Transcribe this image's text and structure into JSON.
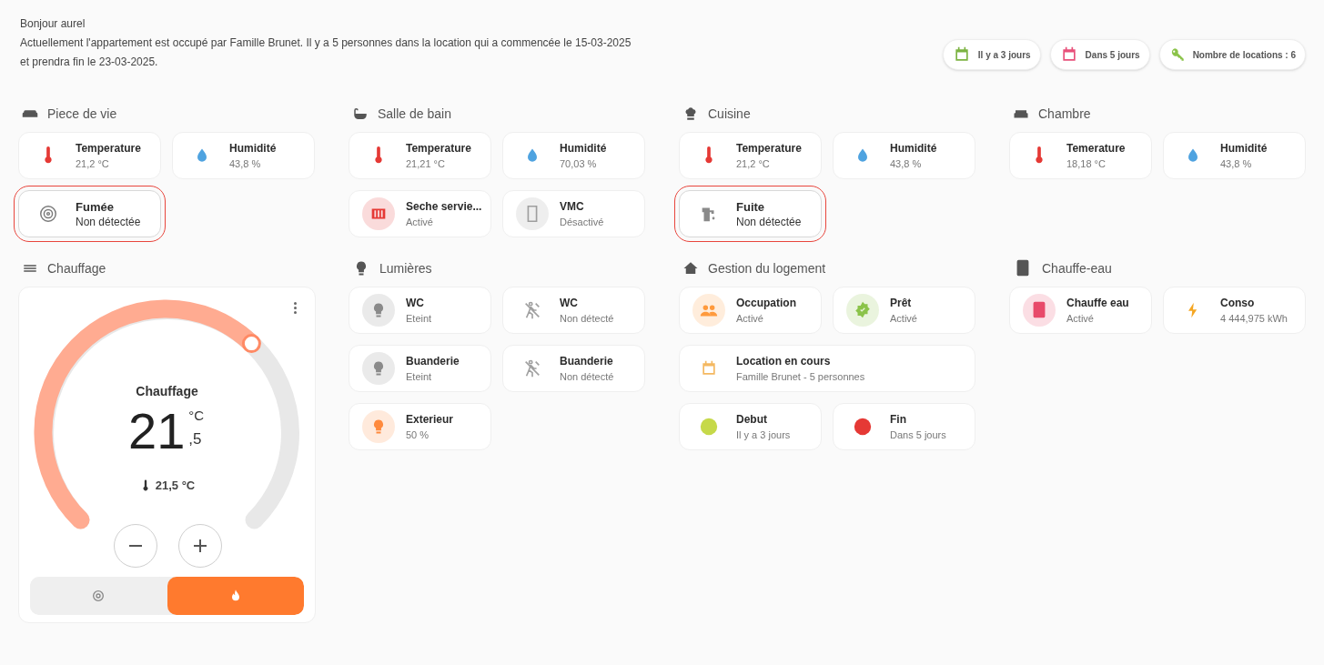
{
  "greeting": "Bonjour aurel",
  "summary": "Actuellement l'appartement est occupé par Famille Brunet. Il y a 5 personnes dans la location qui a commencée le 15-03-2025 et prendra fin le 23-03-2025.",
  "chips": [
    {
      "color": "#7cb342",
      "label": "Il y a 3 jours"
    },
    {
      "color": "#e8507a",
      "label": "Dans 5 jours"
    },
    {
      "color": "#8bc34a",
      "label": "Nombre de locations : 6"
    }
  ],
  "sections": [
    {
      "kind": "tiles",
      "title": "Piece de vie",
      "tiles": [
        {
          "title": "Temperature",
          "state": "21,2 °C",
          "kind": "thermometer",
          "color": "#e53935",
          "filled": false,
          "highlighted": false
        },
        {
          "title": "Humidité",
          "state": "43,8 %",
          "kind": "drop",
          "color": "#4fa3e0",
          "filled": false,
          "highlighted": false
        },
        {
          "title": "Fumée",
          "state": "Non détectée",
          "kind": "smoke",
          "color": "#7a7a7a",
          "filled": false,
          "highlighted": true
        }
      ]
    },
    {
      "kind": "tiles",
      "title": "Salle de bain",
      "tiles": [
        {
          "title": "Temperature",
          "state": "21,21 °C",
          "kind": "thermometer",
          "color": "#e53935",
          "filled": false,
          "highlighted": false
        },
        {
          "title": "Humidité",
          "state": "70,03 %",
          "kind": "drop",
          "color": "#4fa3e0",
          "filled": false,
          "highlighted": false
        },
        {
          "title": "Seche servie...",
          "state": "Activé",
          "kind": "radiator",
          "color": "#e53935",
          "filled": true,
          "highlighted": false
        },
        {
          "title": "VMC",
          "state": "Désactivé",
          "kind": "phone",
          "color": "#9e9e9e",
          "filled": true,
          "highlighted": false
        }
      ]
    },
    {
      "kind": "tiles",
      "title": "Cuisine",
      "tiles": [
        {
          "title": "Temperature",
          "state": "21,2 °C",
          "kind": "thermometer",
          "color": "#e53935",
          "filled": false,
          "highlighted": false
        },
        {
          "title": "Humidité",
          "state": "43,8 %",
          "kind": "drop",
          "color": "#4fa3e0",
          "filled": false,
          "highlighted": false
        },
        {
          "title": "Fuite",
          "state": "Non détectée",
          "kind": "faucet",
          "color": "#8a8a8a",
          "filled": false,
          "highlighted": true
        }
      ]
    },
    {
      "kind": "tiles",
      "title": "Chambre",
      "tiles": [
        {
          "title": "Temerature",
          "state": "18,18 °C",
          "kind": "thermometer",
          "color": "#e53935",
          "filled": false,
          "highlighted": false
        },
        {
          "title": "Humidité",
          "state": "43,8 %",
          "kind": "drop",
          "color": "#4fa3e0",
          "filled": false,
          "highlighted": false
        }
      ]
    },
    {
      "kind": "thermostat",
      "title": "Chauffage",
      "thermostat": {
        "name": "Chauffage",
        "whole": "21",
        "unit": "°C",
        "decimal": ",5",
        "current": "21,5 °C",
        "modes": [
          {
            "kind": "power",
            "selected": false
          },
          {
            "kind": "flame",
            "selected": true
          }
        ]
      }
    },
    {
      "kind": "tiles",
      "title": "Lumières",
      "tiles": [
        {
          "title": "WC",
          "state": "Eteint",
          "kind": "bulb",
          "color": "#8a8a8a",
          "filled": true,
          "highlighted": false
        },
        {
          "title": "WC",
          "state": "Non détecté",
          "kind": "motion",
          "color": "#a0a0a0",
          "filled": false,
          "highlighted": false
        },
        {
          "title": "Buanderie",
          "state": "Eteint",
          "kind": "bulb",
          "color": "#8a8a8a",
          "filled": true,
          "highlighted": false
        },
        {
          "title": "Buanderie",
          "state": "Non détecté",
          "kind": "motion",
          "color": "#a0a0a0",
          "filled": false,
          "highlighted": false
        },
        {
          "title": "Exterieur",
          "state": "50 %",
          "kind": "bulb",
          "color": "#ff8a3d",
          "filled": true,
          "highlighted": false
        }
      ]
    },
    {
      "kind": "tiles",
      "title": "Gestion du logement",
      "tiles": [
        {
          "title": "Occupation",
          "state": "Activé",
          "kind": "people",
          "color": "#ff9a3c",
          "filled": true,
          "highlighted": false
        },
        {
          "title": "Prêt",
          "state": "Activé",
          "kind": "check",
          "color": "#8bc34a",
          "filled": true,
          "highlighted": false
        },
        {
          "title": "Location en cours",
          "state": "Famille Brunet - 5 personnes",
          "kind": "calendar",
          "color": "#f4b860",
          "filled": false,
          "highlighted": false,
          "wide": true
        },
        {
          "title": "Debut",
          "state": "Il y a 3 jours",
          "kind": "dot",
          "color": "#c6d94a",
          "filled": false,
          "highlighted": false
        },
        {
          "title": "Fin",
          "state": "Dans 5 jours",
          "kind": "dot",
          "color": "#e53935",
          "filled": false,
          "highlighted": false
        }
      ]
    },
    {
      "kind": "tiles",
      "title": "Chauffe-eau",
      "tiles": [
        {
          "title": "Chauffe eau",
          "state": "Activé",
          "kind": "boiler",
          "color": "#e84a6a",
          "filled": true,
          "highlighted": false
        },
        {
          "title": "Conso",
          "state": "4 444,975 kWh",
          "kind": "bolt",
          "color": "#f5a623",
          "filled": false,
          "highlighted": false
        }
      ]
    }
  ]
}
